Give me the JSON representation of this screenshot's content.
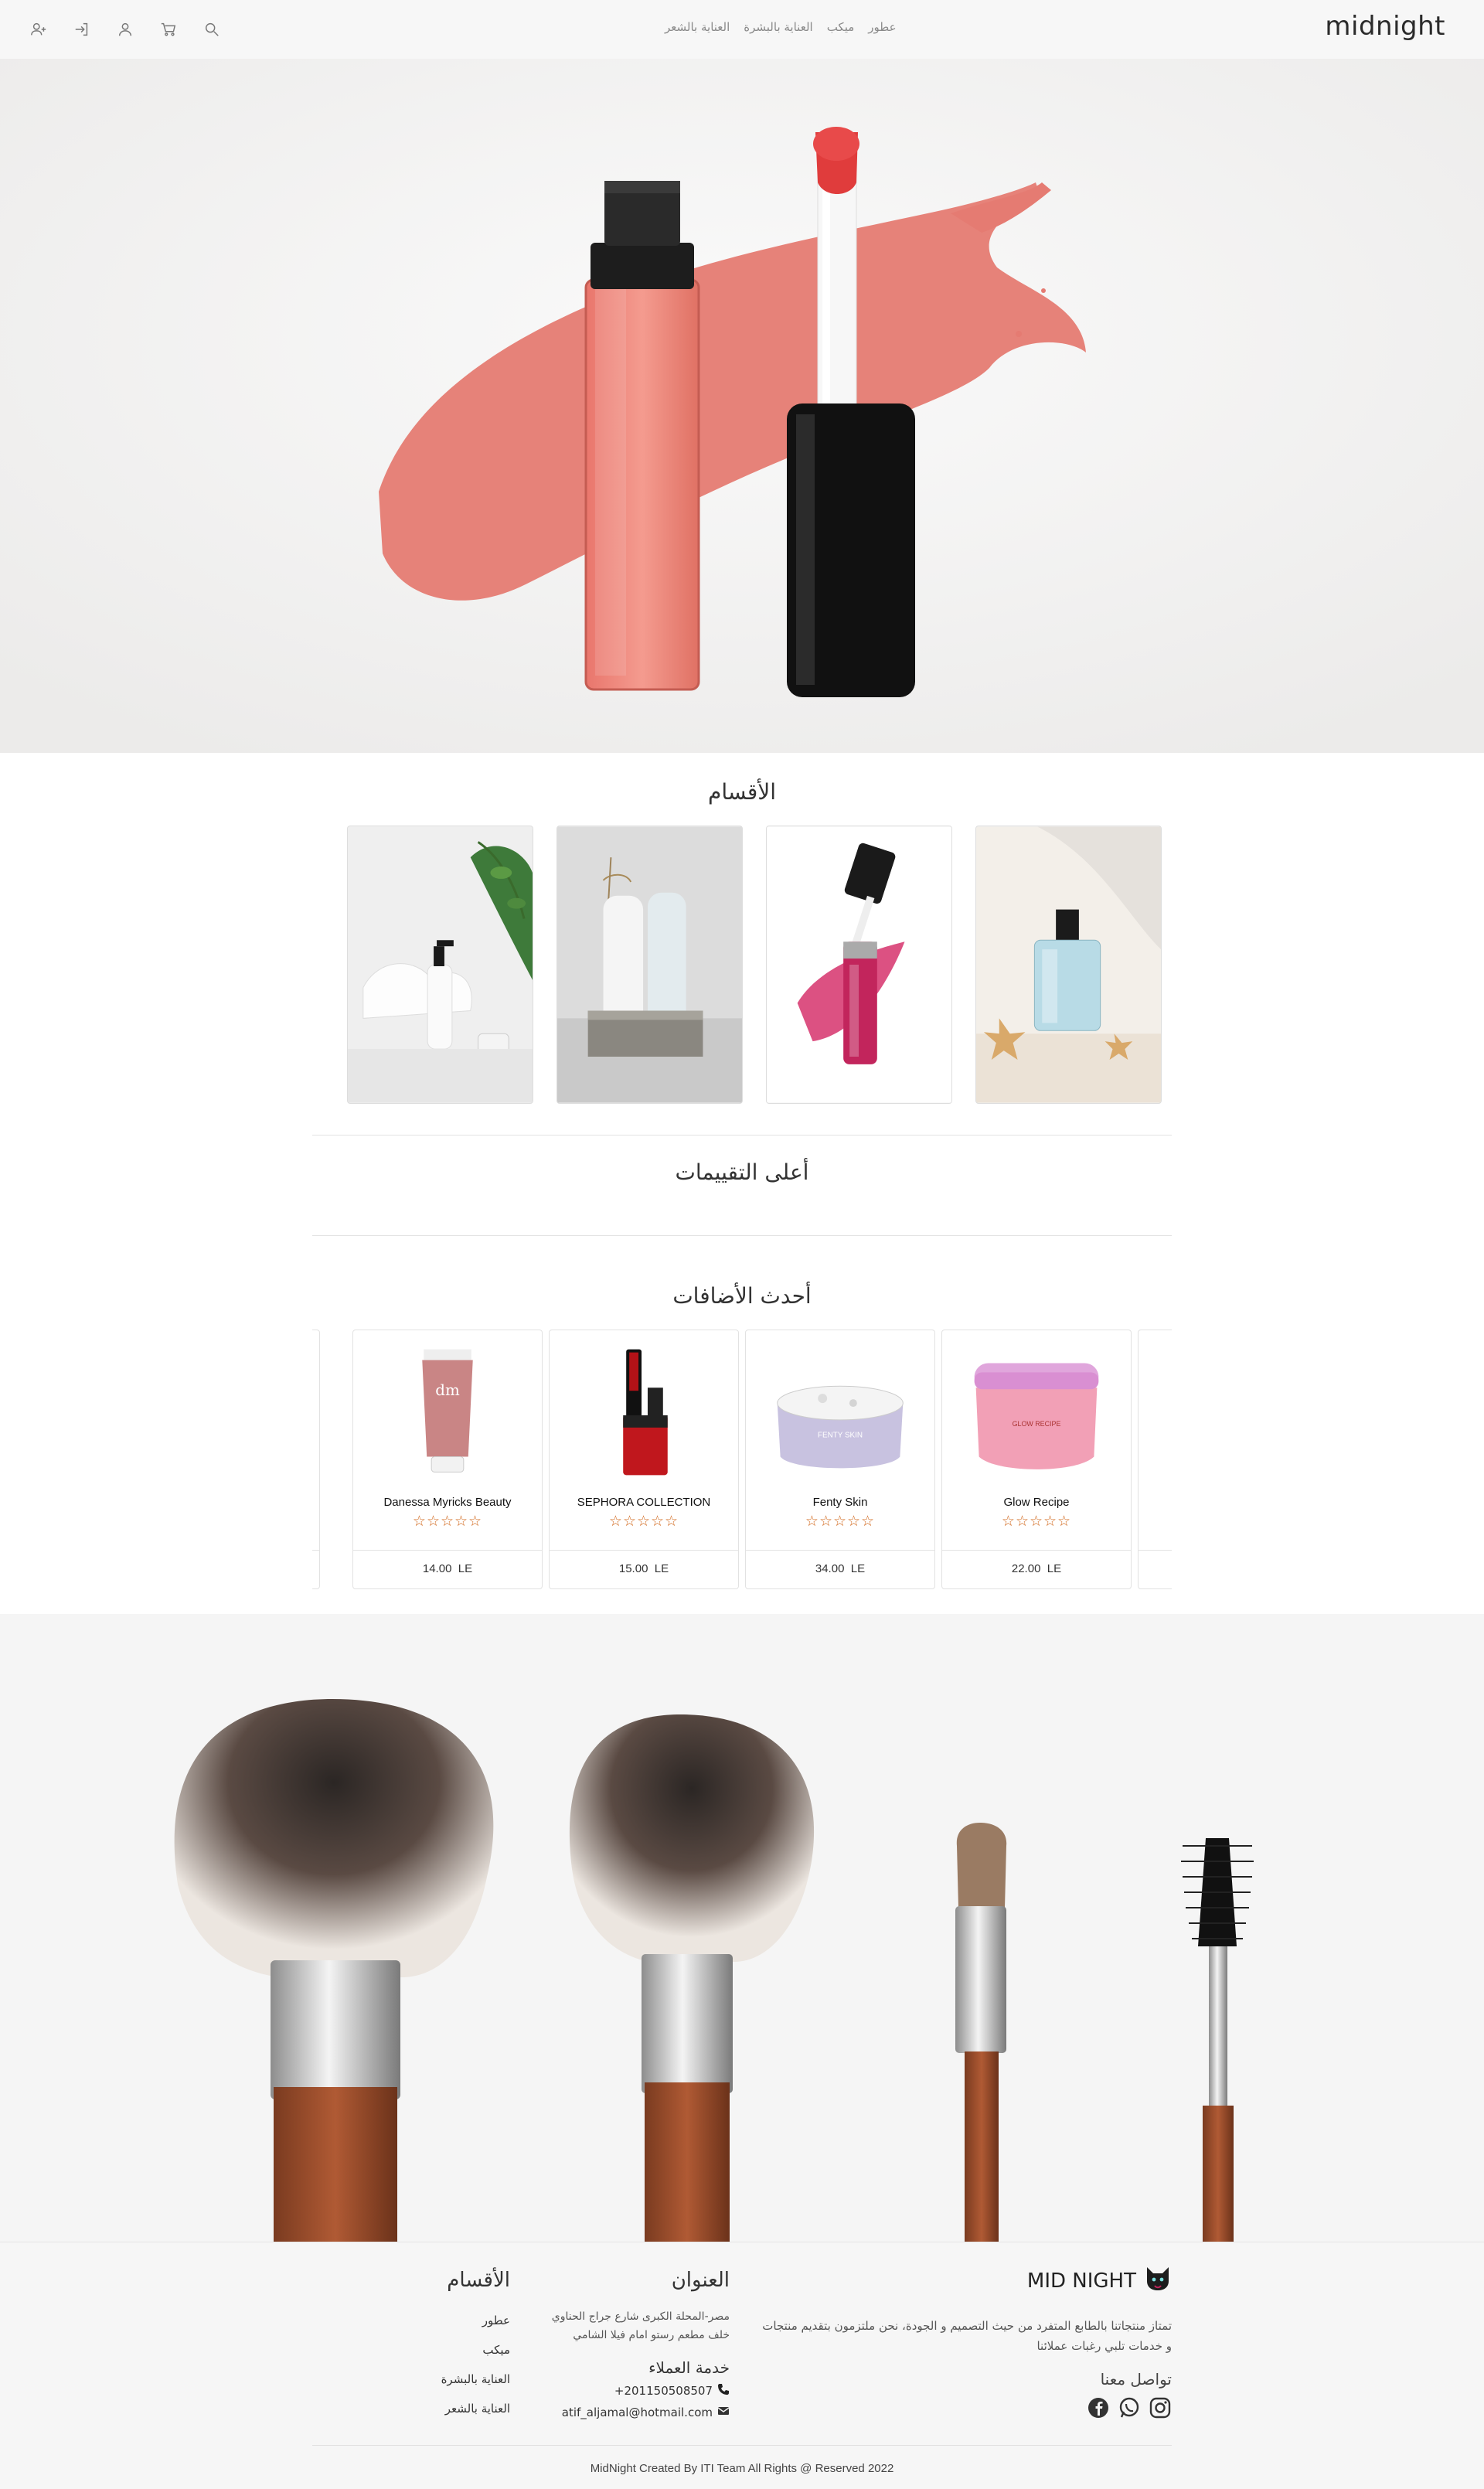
{
  "nav": {
    "brand": "midnight",
    "links": [
      "عطور",
      "ميكب",
      "العناية بالبشرة",
      "العناية بالشعر"
    ],
    "icons": [
      "search-icon",
      "cart-icon",
      "user-icon",
      "logout-icon",
      "add-user-icon"
    ]
  },
  "categories": {
    "title": "الأقسام",
    "items": [
      "perfume",
      "lip-gloss",
      "skincare-bottles",
      "soap-dispenser"
    ]
  },
  "top_rated": {
    "title": "أعلى التقييمات"
  },
  "latest": {
    "title": "أحدث الأضافات",
    "products": [
      {
        "name": "Glow Recipe",
        "price": "22.00",
        "currency": "LE",
        "rating": 0
      },
      {
        "name": "Fenty Skin",
        "price": "34.00",
        "currency": "LE",
        "rating": 0
      },
      {
        "name": "SEPHORA COLLECTION",
        "price": "15.00",
        "currency": "LE",
        "rating": 0
      },
      {
        "name": "Danessa Myricks Beauty",
        "price": "14.00",
        "currency": "LE",
        "rating": 0
      }
    ],
    "stars": "☆☆☆☆☆"
  },
  "footer": {
    "brand": "MID NIGHT",
    "about": "تمتاز منتجاتنا بالطابع المتفرد من حيث التصميم و الجودة، نحن ملتزمون بتقديم منتجات و خدمات تلبي رغبات عملائنا",
    "contact_heading": "تواصل معنا",
    "social": [
      "instagram-icon",
      "whatsapp-icon",
      "facebook-icon"
    ],
    "address_heading": "العنوان",
    "address": "مصر-المحلة الكبرى شارع جراج الحناوي خلف مطعم رستو امام فيلا الشامي",
    "service_heading": "خدمة العملاء",
    "phone": "+201150508507",
    "email": "atif_aljamal@hotmail.com",
    "categories_heading": "الأقسام",
    "categories": [
      "عطور",
      "ميكب",
      "العناية بالبشرة",
      "العناية بالشعر"
    ],
    "copyright": "MidNight Created By ITI Team All Rights @ Reserved 2022"
  }
}
